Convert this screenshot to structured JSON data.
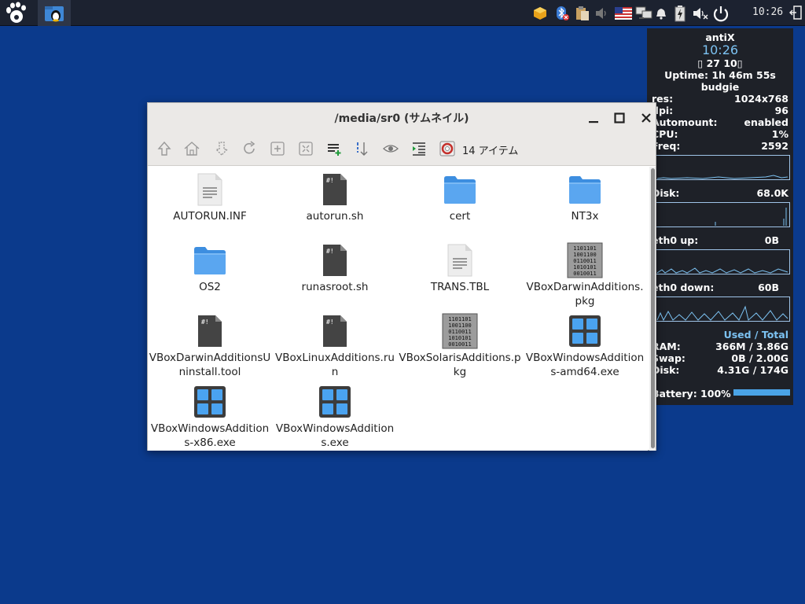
{
  "panel": {
    "clock": "10:26"
  },
  "conky": {
    "distro": "antiX",
    "time": "10:26",
    "date": "▯ 27 10▯",
    "uptime": "Uptime: 1h 46m 55s",
    "host": "budgie",
    "res_label": "res:",
    "res_value": "1024x768",
    "dpi_label": "dpi:",
    "dpi_value": "96",
    "automount_label": "Automount:",
    "automount_value": "enabled",
    "cpu_label": "CPU:",
    "cpu_value": "1%",
    "freq_label": "Freq:",
    "freq_value": "2592",
    "disk_label": "Disk:",
    "disk_value": "68.0K",
    "eth0up_label": "eth0 up:",
    "eth0up_value": "0B",
    "eth0down_label": "eth0 down:",
    "eth0down_value": "60B",
    "used_total": "Used / Total",
    "ram_label": "RAM:",
    "ram_value": "366M  / 3.86G",
    "swap_label": "Swap:",
    "swap_value": "0B  / 2.00G",
    "hdisk_label": "Disk:",
    "hdisk_value": "4.31G / 174G",
    "battery": "Battery: 100%",
    "battery_level": 1.0,
    "accent": "#7cc2f2"
  },
  "window": {
    "title": "/media/sr0 (サムネイル)",
    "item_count": "14 アイテム"
  },
  "files": [
    {
      "name": "AUTORUN.INF",
      "icon": "text-file-icon"
    },
    {
      "name": "autorun.sh",
      "icon": "script-file-icon"
    },
    {
      "name": "cert",
      "icon": "folder-icon"
    },
    {
      "name": "NT3x",
      "icon": "folder-icon"
    },
    {
      "name": "OS2",
      "icon": "folder-icon"
    },
    {
      "name": "runasroot.sh",
      "icon": "script-file-icon"
    },
    {
      "name": "TRANS.TBL",
      "icon": "text-file-icon"
    },
    {
      "name": "VBoxDarwinAdditions.pkg",
      "icon": "binary-file-icon"
    },
    {
      "name": "VBoxDarwinAdditionsUninstall.tool",
      "icon": "script-file-icon"
    },
    {
      "name": "VBoxLinuxAdditions.run",
      "icon": "script-file-icon"
    },
    {
      "name": "VBoxSolarisAdditions.pkg",
      "icon": "binary-file-icon"
    },
    {
      "name": "VBoxWindowsAdditions-amd64.exe",
      "icon": "windows-exe-icon"
    },
    {
      "name": "VBoxWindowsAdditions-x86.exe",
      "icon": "windows-exe-icon"
    },
    {
      "name": "VBoxWindowsAdditions.exe",
      "icon": "windows-exe-icon"
    }
  ],
  "binary_text": [
    "1101101",
    "1001100",
    "0110011",
    "1010101",
    "0010011"
  ]
}
